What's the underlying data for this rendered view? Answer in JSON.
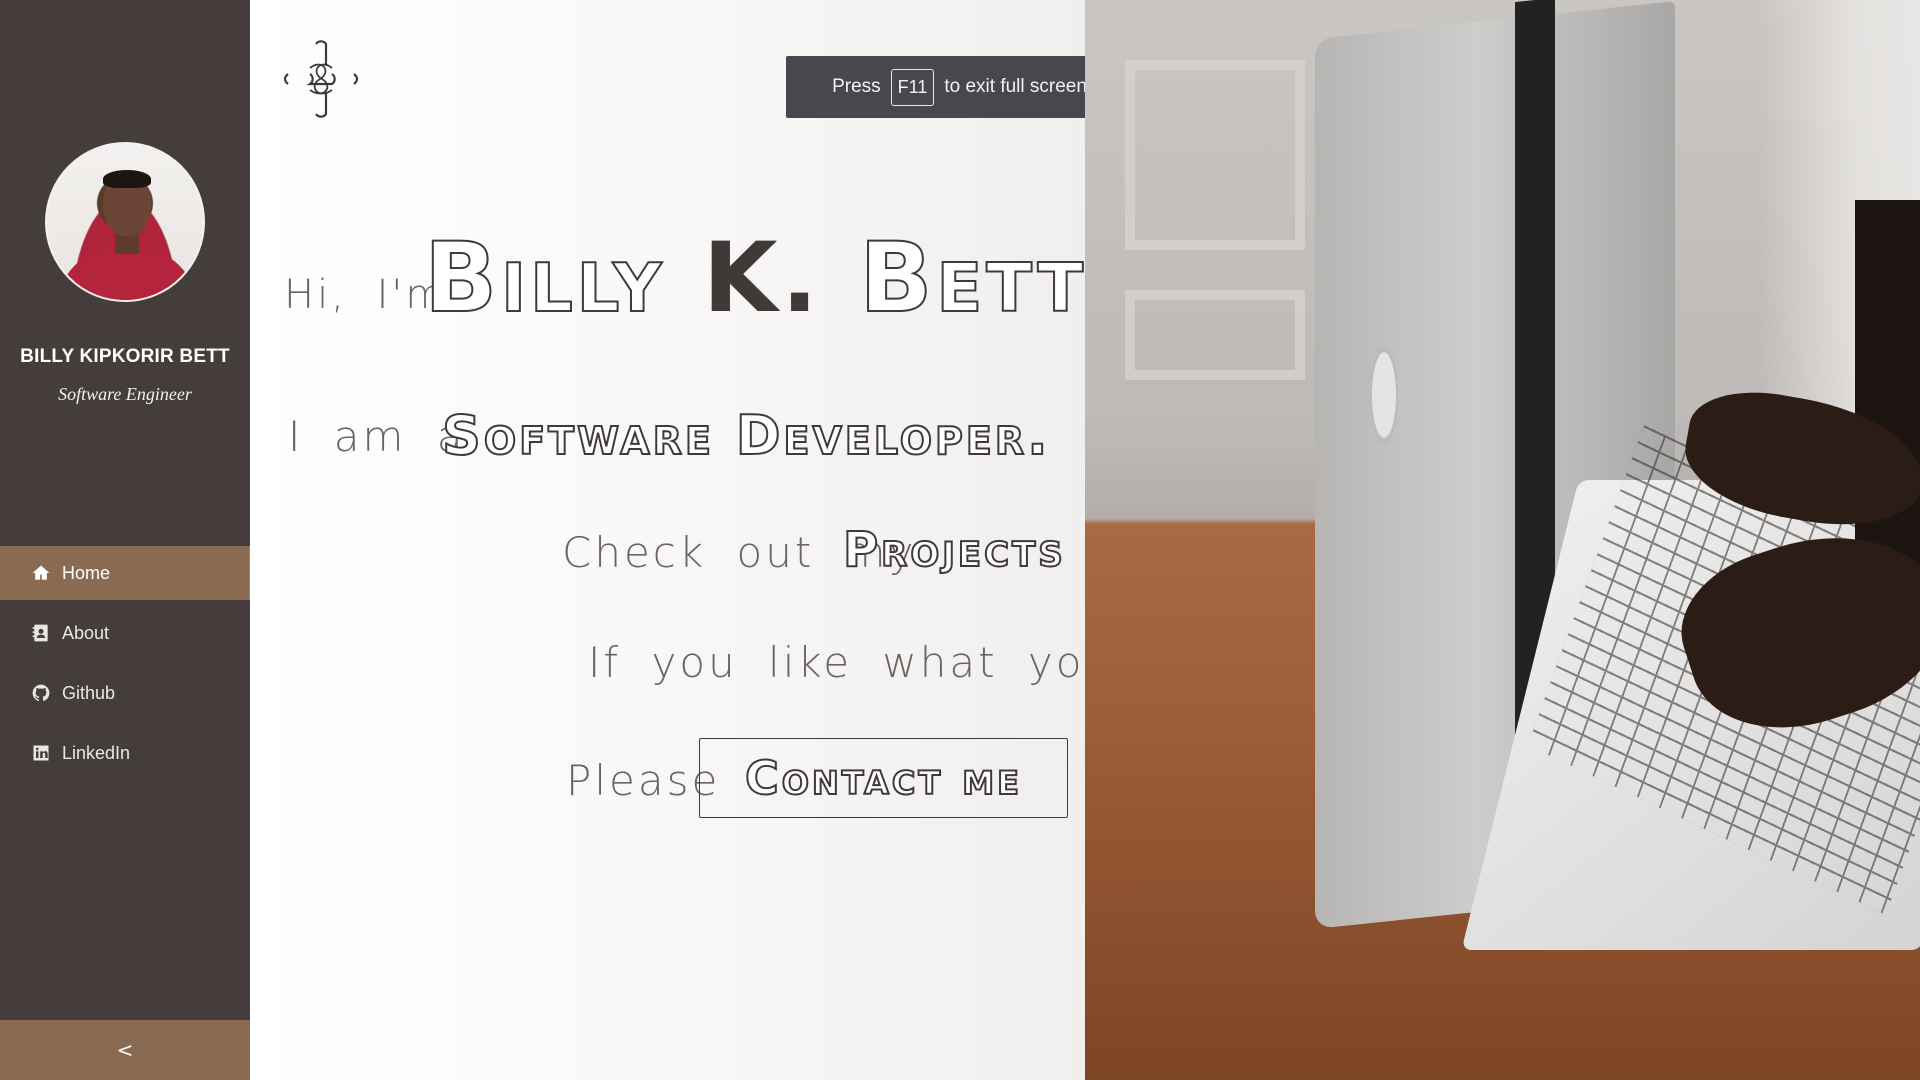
{
  "sidebar": {
    "user_name": "BILLY KIPKORIR BETT",
    "user_role": "Software Engineer",
    "nav": [
      {
        "label": "Home",
        "icon": "home-icon",
        "active": true
      },
      {
        "label": "About",
        "icon": "contact-card-icon",
        "active": false
      },
      {
        "label": "Github",
        "icon": "github-icon",
        "active": false
      },
      {
        "label": "LinkedIn",
        "icon": "linkedin-icon",
        "active": false
      }
    ],
    "collapse_label": "<"
  },
  "toast": {
    "press": "Press",
    "key": "F11",
    "rest": "to exit full screen"
  },
  "hero": {
    "hi": "Hi, I'm",
    "name_first": "Billy",
    "name_mid": "K.",
    "name_last": "Bett",
    "iam": "I am a",
    "role": "Software Developer.",
    "check": "Check out my",
    "projects": "Projects",
    "like": "If you like what you see",
    "please": "Please",
    "contact": "Contact me"
  },
  "colors": {
    "sidebar_bg": "#443d3b",
    "accent": "#8a6b52",
    "text_dark": "#3f3a38",
    "toast_bg": "#46484d"
  }
}
